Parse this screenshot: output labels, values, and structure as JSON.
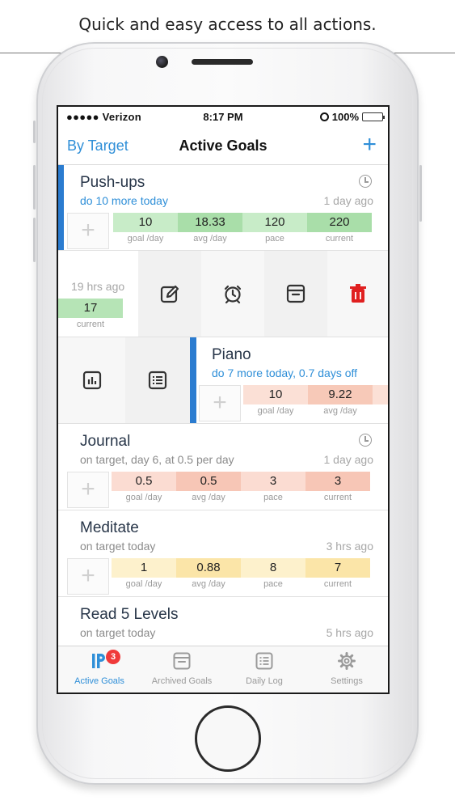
{
  "caption": "Quick and easy access to all actions.",
  "status_bar": {
    "carrier": "●●●●● Verizon",
    "time": "8:17 PM",
    "battery": "100%"
  },
  "nav": {
    "left_label": "By Target",
    "title": "Active Goals",
    "add_label": "+"
  },
  "goals": [
    {
      "name": "Push-ups",
      "subtitle": "do 10 more today",
      "time": "1 day ago",
      "stats": [
        {
          "value": "10",
          "label": "goal /day",
          "color": "#c8ecc8"
        },
        {
          "value": "18.33",
          "label": "avg /day",
          "color": "#a9dea9"
        },
        {
          "value": "120",
          "label": "pace",
          "color": "#c8ecc8"
        },
        {
          "value": "220",
          "label": "current",
          "color": "#a9dea9"
        }
      ]
    },
    {
      "time": "19 hrs ago",
      "stat": {
        "value": "17",
        "label": "current",
        "color": "#b6e4b6"
      }
    },
    {
      "name": "Piano",
      "subtitle": "do 7 more today, 0.7 days off",
      "stats": [
        {
          "value": "10",
          "label": "goal /day",
          "color": "#fbe0d6"
        },
        {
          "value": "9.22",
          "label": "avg /day",
          "color": "#f7c9b8"
        }
      ]
    },
    {
      "name": "Journal",
      "subtitle": "on target, day 6, at 0.5 per day",
      "time": "1 day ago",
      "stats": [
        {
          "value": "0.5",
          "label": "goal /day",
          "color": "#fbdcd2"
        },
        {
          "value": "0.5",
          "label": "avg /day",
          "color": "#f7c6b6"
        },
        {
          "value": "3",
          "label": "pace",
          "color": "#fbdcd2"
        },
        {
          "value": "3",
          "label": "current",
          "color": "#f7c6b6"
        }
      ]
    },
    {
      "name": "Meditate",
      "subtitle": "on target today",
      "time": "3 hrs ago",
      "stats": [
        {
          "value": "1",
          "label": "goal /day",
          "color": "#fdf1cc"
        },
        {
          "value": "0.88",
          "label": "avg /day",
          "color": "#fbe5a8"
        },
        {
          "value": "8",
          "label": "pace",
          "color": "#fdf1cc"
        },
        {
          "value": "7",
          "label": "current",
          "color": "#fbe5a8"
        }
      ]
    },
    {
      "name": "Read 5 Levels",
      "subtitle": "on target today",
      "time": "5 hrs ago"
    }
  ],
  "actions": [
    "edit-icon",
    "alarm-clock-icon",
    "archive-icon",
    "trash-icon"
  ],
  "left_actions": [
    "bar-chart-icon",
    "list-icon"
  ],
  "tabs": [
    {
      "label": "Active Goals",
      "badge": "3"
    },
    {
      "label": "Archived Goals"
    },
    {
      "label": "Daily Log"
    },
    {
      "label": "Settings"
    }
  ],
  "colors": {
    "accent": "#2f8fd8",
    "goal_bar": "#2b7cd0",
    "delete": "#e02020"
  }
}
